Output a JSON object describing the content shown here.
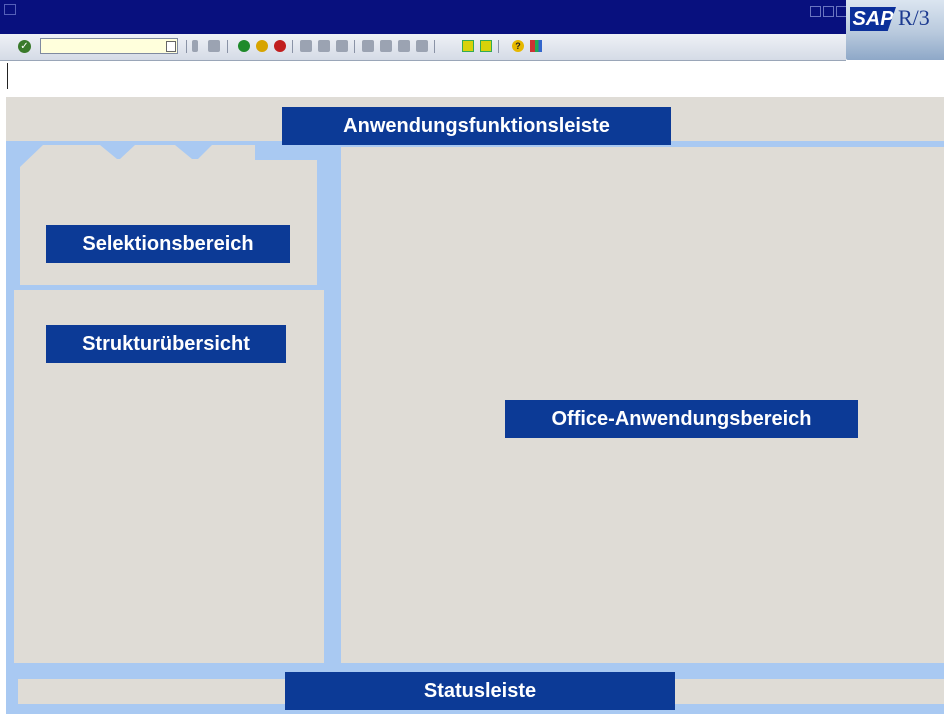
{
  "colors": {
    "title_bar": "#08107e",
    "frame": "#a9c9f2",
    "panel": "#dfdcd6",
    "label_bg": "#0c3a96",
    "label_text": "#ffffff"
  },
  "logo": {
    "brand": "SAP",
    "product": "R/3"
  },
  "toolbar": {
    "command_field_value": "",
    "icons": [
      "enter-icon",
      "save-icon",
      "back-icon",
      "exit-icon",
      "cancel-icon",
      "print-icon",
      "find-icon",
      "find-next-icon",
      "first-page-icon",
      "previous-page-icon",
      "next-page-icon",
      "last-page-icon",
      "create-session-icon",
      "shortcut-icon",
      "help-icon",
      "customize-layout-icon"
    ]
  },
  "labels": {
    "application_toolbar": "Anwendungsfunktionsleiste",
    "selection_area": "Selektionsbereich",
    "structure_overview": "Strukturübersicht",
    "office_application_area": "Office-Anwendungsbereich",
    "status_bar": "Statusleiste"
  }
}
